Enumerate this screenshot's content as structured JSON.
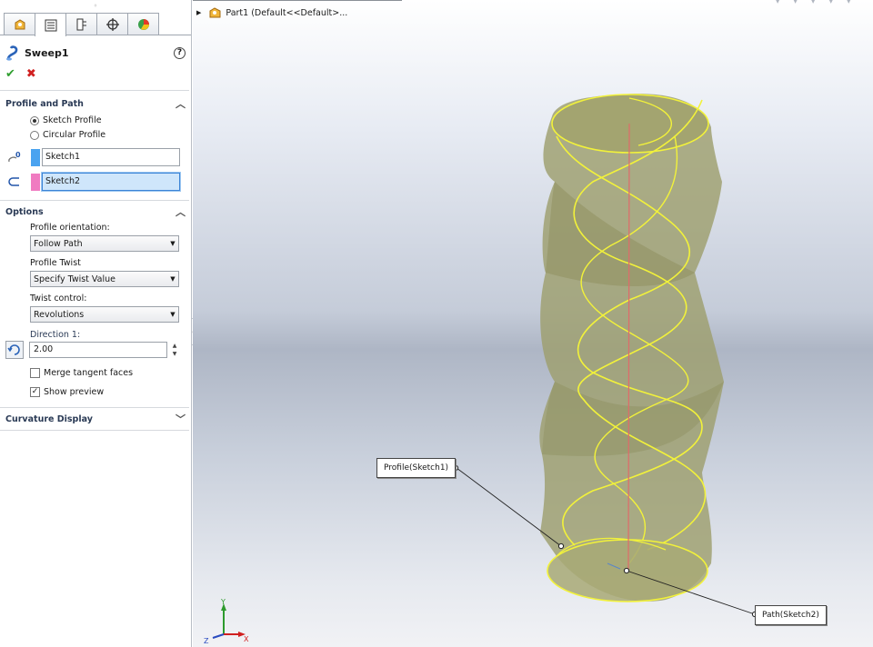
{
  "panel": {
    "feature_name": "Sweep1",
    "help_glyph": "?",
    "ok_glyph": "✔",
    "cancel_glyph": "✖",
    "grip_glyph": "◦",
    "profile_and_path": {
      "title": "Profile and Path",
      "radio_sketch_profile": "Sketch Profile",
      "radio_circular_profile": "Circular Profile",
      "selected_radio": "Sketch Profile",
      "profile_selection": "Sketch1",
      "path_selection": "Sketch2",
      "profile_color": "#4aa3f0",
      "path_color": "#f07bc1"
    },
    "options": {
      "title": "Options",
      "profile_orientation_label": "Profile orientation:",
      "profile_orientation_value": "Follow Path",
      "profile_twist_label": "Profile Twist",
      "profile_twist_value": "Specify Twist Value",
      "twist_control_label": "Twist control:",
      "twist_control_value": "Revolutions",
      "direction_label": "Direction 1:",
      "direction_value": "2.00",
      "merge_tangent_label": "Merge tangent faces",
      "merge_tangent_checked": false,
      "show_preview_label": "Show preview",
      "show_preview_checked": true
    },
    "curvature": {
      "title": "Curvature Display"
    }
  },
  "viewport": {
    "tree_label": "Part1  (Default<<Default>...",
    "callout_profile": "Profile(Sketch1)",
    "callout_path": "Path(Sketch2)",
    "axis_y": "Y",
    "axis_x": "X",
    "axis_z": "Z",
    "preview_color": "#9e9f6e",
    "edge_color": "#f2f23a",
    "path_line_color": "#e06a6a"
  }
}
